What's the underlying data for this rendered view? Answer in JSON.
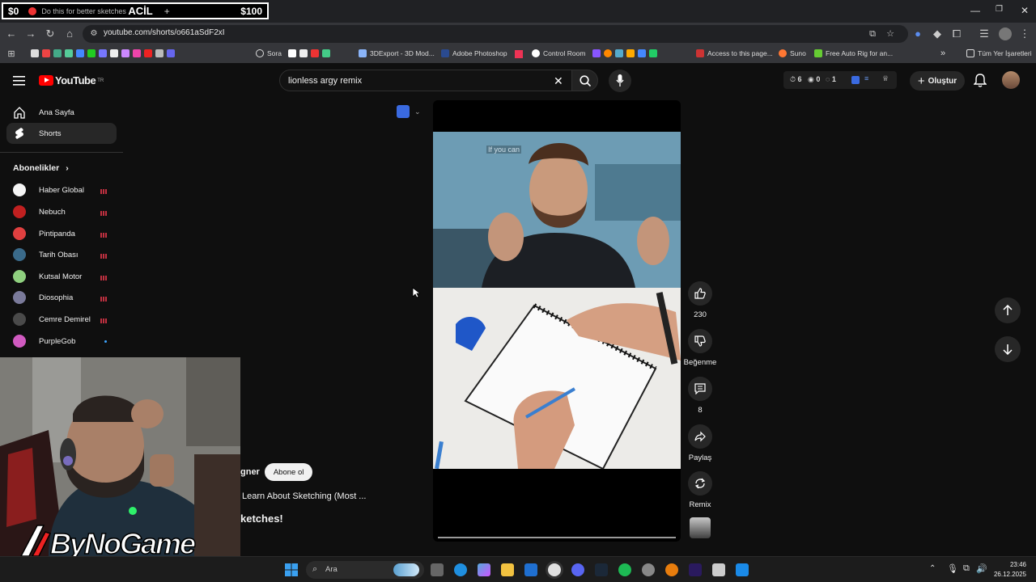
{
  "overlay": {
    "left": "$0",
    "tab_title": "Do this for better sketches!",
    "mid": "ACİL",
    "right": "$100"
  },
  "browser": {
    "url": "youtube.com/shorts/o661aSdF2xI",
    "bookmarks": [
      {
        "label": "Sora",
        "color": "#ffffff"
      },
      {
        "label": "3DExport - 3D Mod...",
        "color": "#8ab4f8"
      },
      {
        "label": "Adobe Photoshop",
        "color": "#2a7fff"
      },
      {
        "label": "Control Room",
        "color": "#ffffff"
      },
      {
        "label": "Access to this page...",
        "color": "#d33"
      },
      {
        "label": "Suno",
        "color": "#ff7a2a"
      },
      {
        "label": "Free Auto Rig for an...",
        "color": "#6c3"
      }
    ],
    "all_bookmarks": "Tüm Yer İşaretleri"
  },
  "youtube": {
    "logo_text": "YouTube",
    "logo_sup": "TR",
    "search_query": "lionless argy remix",
    "ext_counts": [
      "6",
      "0",
      "1"
    ],
    "create_label": "Oluştur",
    "nav": [
      {
        "label": "Ana Sayfa"
      },
      {
        "label": "Shorts"
      }
    ],
    "subscriptions_heading": "Abonelikler",
    "subscriptions": [
      {
        "name": "Haber Global",
        "color": "#f5f5f5"
      },
      {
        "name": "Nebuch",
        "color": "#c02020"
      },
      {
        "name": "Pintipanda",
        "color": "#e04040"
      },
      {
        "name": "Tarih Obası",
        "color": "#3a6a8a"
      },
      {
        "name": "Kutsal Motor",
        "color": "#8fd07f"
      },
      {
        "name": "Diosophia",
        "color": "#7a7a9a"
      },
      {
        "name": "Cemre Demirel",
        "color": "#4a4a4a"
      },
      {
        "name": "PurpleGob",
        "color": "#d05ac0"
      }
    ],
    "channel_name": "gner",
    "subscribe_label": "Abone ol",
    "short_title": "Learn About Sketching (Most ...",
    "short_heading": "ketches!",
    "caption": "If you can",
    "actions": {
      "like_count": "230",
      "dislike_label": "Beğenme",
      "comment_count": "8",
      "share_label": "Paylaş",
      "remix_label": "Remix"
    }
  },
  "brand": {
    "text": "ByNoGame"
  },
  "taskbar": {
    "search_label": "Ara",
    "time": "23:46",
    "date": "26.12.2025"
  }
}
